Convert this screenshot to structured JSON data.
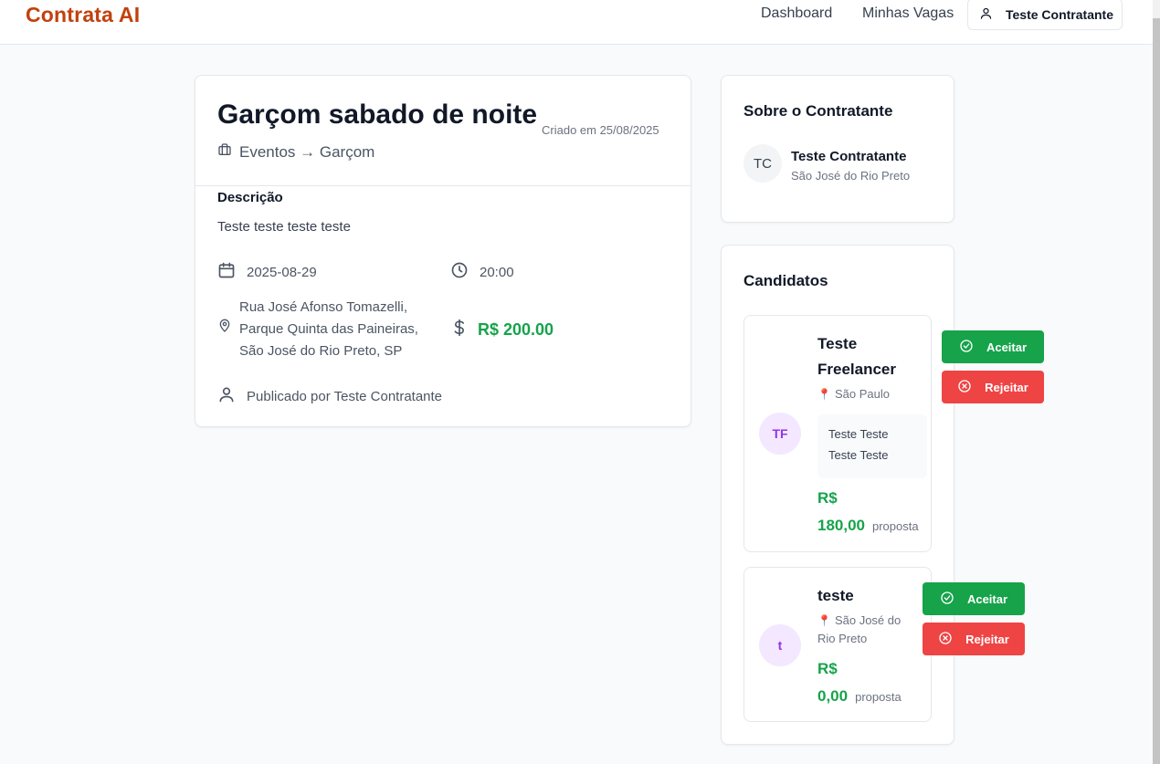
{
  "nav": {
    "brand": "Contrata AI",
    "dashboard": "Dashboard",
    "my_jobs": "Minhas Vagas",
    "user": "Teste Contratante"
  },
  "job": {
    "title": "Garçom sabado de noite",
    "created": "Criado em 25/08/2025",
    "category": "Eventos → Garçom",
    "description_label": "Descrição",
    "description": "Teste teste teste teste",
    "date": "2025-08-29",
    "time": "20:00",
    "address_line1": "Rua José Afonso Tomazelli,",
    "address_line2": "Parque Quinta das Paineiras,",
    "address_line3": "São José do Rio Preto, SP",
    "price": "R$ 200.00",
    "published_by": "Publicado por Teste Contratante"
  },
  "about": {
    "title": "Sobre o Contratante",
    "initials": "TC",
    "name": "Teste Contratante",
    "city": "São José do Rio Preto"
  },
  "candidates": {
    "title": "Candidatos",
    "accept_label": "Aceitar",
    "reject_label": "Rejeitar",
    "proposal_label": "proposta",
    "currency": "R$",
    "items": [
      {
        "initials": "TF",
        "name": "Teste Freelancer",
        "city": "São Paulo",
        "message_line1": "Teste Teste",
        "message_line2": "Teste Teste",
        "amount": "180,00"
      },
      {
        "initials": "t",
        "name": "teste",
        "city": "São José do Rio Preto",
        "amount": "0,00"
      }
    ]
  },
  "colors": {
    "brand": "#c2410c",
    "accept": "#16a34a",
    "reject": "#ef4444",
    "price": "#16a34a",
    "avatar_bg": "#f3e8ff"
  }
}
